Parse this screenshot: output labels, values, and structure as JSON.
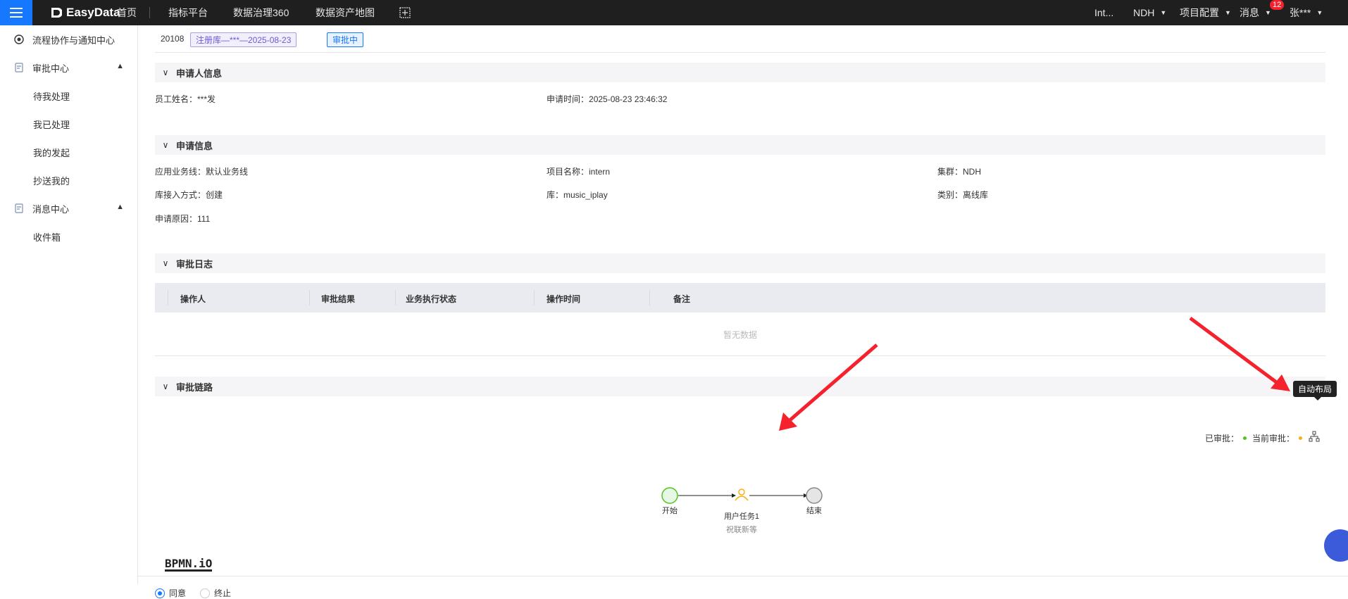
{
  "topbar": {
    "logo_text": "EasyData",
    "nav": [
      "首页",
      "指标平台",
      "数据治理360",
      "数据资产地图"
    ],
    "right_items": [
      "Int...",
      "NDH",
      "项目配置",
      "消息",
      "张***"
    ],
    "message_count": "12",
    "brand_color": "#1677ff"
  },
  "sidebar": {
    "workflow_center": "流程协作与通知中心",
    "approval_center": "审批中心",
    "approval_items": [
      "待我处理",
      "我已处理",
      "我的发起",
      "抄送我的"
    ],
    "message_center": "消息中心",
    "message_items": [
      "收件箱"
    ]
  },
  "header": {
    "id": "20108",
    "title_tag": "注册库—***—2025-08-23",
    "status_tag": "审批中"
  },
  "applicant": {
    "section_title": "申请人信息",
    "name_label": "员工姓名：",
    "name_value": "***发",
    "time_label": "申请时间：",
    "time_value": "2025-08-23 23:46:32"
  },
  "application": {
    "section_title": "申请信息",
    "business_line_label": "应用业务线：",
    "business_line_value": "默认业务线",
    "project_label": "项目名称：",
    "project_value": "intern",
    "cluster_label": "集群：",
    "cluster_value": "NDH",
    "access_label": "库接入方式：",
    "access_value": "创建",
    "db_label": "库：",
    "db_value": "music_iplay",
    "type_label": "类别：",
    "type_value": "离线库",
    "reason_label": "申请原因：",
    "reason_value": "111"
  },
  "log": {
    "section_title": "审批日志",
    "columns": [
      "操作人",
      "审批结果",
      "业务执行状态",
      "操作时间",
      "备注"
    ],
    "empty_text": "暂无数据"
  },
  "chain": {
    "section_title": "审批链路",
    "tooltip": "自动布局",
    "legend_approved": "已审批：",
    "legend_current": "当前审批：",
    "approved_color": "#52c41a",
    "current_color": "#faad14",
    "nodes": {
      "start": "开始",
      "task": "用户任务1",
      "task_assignee": "祝联新等",
      "end": "结束"
    },
    "bpmn_logo": "BPMN.iO"
  },
  "decision": {
    "agree": "同意",
    "terminate": "终止"
  }
}
